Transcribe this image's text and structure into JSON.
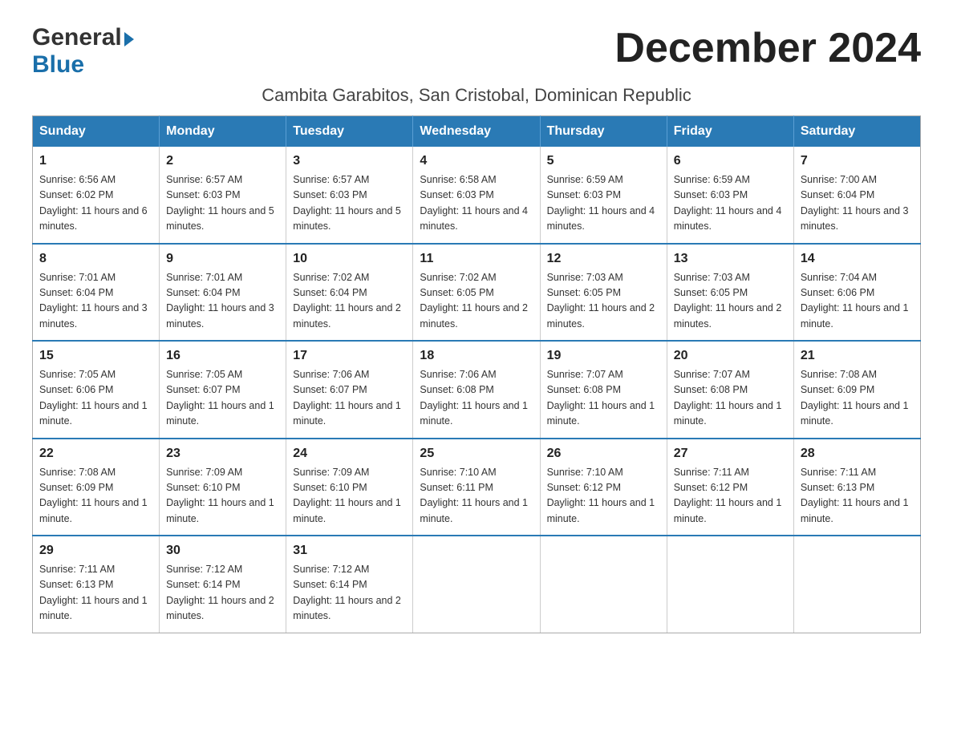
{
  "header": {
    "logo_general": "General",
    "logo_blue": "Blue",
    "month_title": "December 2024",
    "location": "Cambita Garabitos, San Cristobal, Dominican Republic"
  },
  "weekdays": [
    "Sunday",
    "Monday",
    "Tuesday",
    "Wednesday",
    "Thursday",
    "Friday",
    "Saturday"
  ],
  "weeks": [
    [
      {
        "day": "1",
        "sunrise": "Sunrise: 6:56 AM",
        "sunset": "Sunset: 6:02 PM",
        "daylight": "Daylight: 11 hours and 6 minutes."
      },
      {
        "day": "2",
        "sunrise": "Sunrise: 6:57 AM",
        "sunset": "Sunset: 6:03 PM",
        "daylight": "Daylight: 11 hours and 5 minutes."
      },
      {
        "day": "3",
        "sunrise": "Sunrise: 6:57 AM",
        "sunset": "Sunset: 6:03 PM",
        "daylight": "Daylight: 11 hours and 5 minutes."
      },
      {
        "day": "4",
        "sunrise": "Sunrise: 6:58 AM",
        "sunset": "Sunset: 6:03 PM",
        "daylight": "Daylight: 11 hours and 4 minutes."
      },
      {
        "day": "5",
        "sunrise": "Sunrise: 6:59 AM",
        "sunset": "Sunset: 6:03 PM",
        "daylight": "Daylight: 11 hours and 4 minutes."
      },
      {
        "day": "6",
        "sunrise": "Sunrise: 6:59 AM",
        "sunset": "Sunset: 6:03 PM",
        "daylight": "Daylight: 11 hours and 4 minutes."
      },
      {
        "day": "7",
        "sunrise": "Sunrise: 7:00 AM",
        "sunset": "Sunset: 6:04 PM",
        "daylight": "Daylight: 11 hours and 3 minutes."
      }
    ],
    [
      {
        "day": "8",
        "sunrise": "Sunrise: 7:01 AM",
        "sunset": "Sunset: 6:04 PM",
        "daylight": "Daylight: 11 hours and 3 minutes."
      },
      {
        "day": "9",
        "sunrise": "Sunrise: 7:01 AM",
        "sunset": "Sunset: 6:04 PM",
        "daylight": "Daylight: 11 hours and 3 minutes."
      },
      {
        "day": "10",
        "sunrise": "Sunrise: 7:02 AM",
        "sunset": "Sunset: 6:04 PM",
        "daylight": "Daylight: 11 hours and 2 minutes."
      },
      {
        "day": "11",
        "sunrise": "Sunrise: 7:02 AM",
        "sunset": "Sunset: 6:05 PM",
        "daylight": "Daylight: 11 hours and 2 minutes."
      },
      {
        "day": "12",
        "sunrise": "Sunrise: 7:03 AM",
        "sunset": "Sunset: 6:05 PM",
        "daylight": "Daylight: 11 hours and 2 minutes."
      },
      {
        "day": "13",
        "sunrise": "Sunrise: 7:03 AM",
        "sunset": "Sunset: 6:05 PM",
        "daylight": "Daylight: 11 hours and 2 minutes."
      },
      {
        "day": "14",
        "sunrise": "Sunrise: 7:04 AM",
        "sunset": "Sunset: 6:06 PM",
        "daylight": "Daylight: 11 hours and 1 minute."
      }
    ],
    [
      {
        "day": "15",
        "sunrise": "Sunrise: 7:05 AM",
        "sunset": "Sunset: 6:06 PM",
        "daylight": "Daylight: 11 hours and 1 minute."
      },
      {
        "day": "16",
        "sunrise": "Sunrise: 7:05 AM",
        "sunset": "Sunset: 6:07 PM",
        "daylight": "Daylight: 11 hours and 1 minute."
      },
      {
        "day": "17",
        "sunrise": "Sunrise: 7:06 AM",
        "sunset": "Sunset: 6:07 PM",
        "daylight": "Daylight: 11 hours and 1 minute."
      },
      {
        "day": "18",
        "sunrise": "Sunrise: 7:06 AM",
        "sunset": "Sunset: 6:08 PM",
        "daylight": "Daylight: 11 hours and 1 minute."
      },
      {
        "day": "19",
        "sunrise": "Sunrise: 7:07 AM",
        "sunset": "Sunset: 6:08 PM",
        "daylight": "Daylight: 11 hours and 1 minute."
      },
      {
        "day": "20",
        "sunrise": "Sunrise: 7:07 AM",
        "sunset": "Sunset: 6:08 PM",
        "daylight": "Daylight: 11 hours and 1 minute."
      },
      {
        "day": "21",
        "sunrise": "Sunrise: 7:08 AM",
        "sunset": "Sunset: 6:09 PM",
        "daylight": "Daylight: 11 hours and 1 minute."
      }
    ],
    [
      {
        "day": "22",
        "sunrise": "Sunrise: 7:08 AM",
        "sunset": "Sunset: 6:09 PM",
        "daylight": "Daylight: 11 hours and 1 minute."
      },
      {
        "day": "23",
        "sunrise": "Sunrise: 7:09 AM",
        "sunset": "Sunset: 6:10 PM",
        "daylight": "Daylight: 11 hours and 1 minute."
      },
      {
        "day": "24",
        "sunrise": "Sunrise: 7:09 AM",
        "sunset": "Sunset: 6:10 PM",
        "daylight": "Daylight: 11 hours and 1 minute."
      },
      {
        "day": "25",
        "sunrise": "Sunrise: 7:10 AM",
        "sunset": "Sunset: 6:11 PM",
        "daylight": "Daylight: 11 hours and 1 minute."
      },
      {
        "day": "26",
        "sunrise": "Sunrise: 7:10 AM",
        "sunset": "Sunset: 6:12 PM",
        "daylight": "Daylight: 11 hours and 1 minute."
      },
      {
        "day": "27",
        "sunrise": "Sunrise: 7:11 AM",
        "sunset": "Sunset: 6:12 PM",
        "daylight": "Daylight: 11 hours and 1 minute."
      },
      {
        "day": "28",
        "sunrise": "Sunrise: 7:11 AM",
        "sunset": "Sunset: 6:13 PM",
        "daylight": "Daylight: 11 hours and 1 minute."
      }
    ],
    [
      {
        "day": "29",
        "sunrise": "Sunrise: 7:11 AM",
        "sunset": "Sunset: 6:13 PM",
        "daylight": "Daylight: 11 hours and 1 minute."
      },
      {
        "day": "30",
        "sunrise": "Sunrise: 7:12 AM",
        "sunset": "Sunset: 6:14 PM",
        "daylight": "Daylight: 11 hours and 2 minutes."
      },
      {
        "day": "31",
        "sunrise": "Sunrise: 7:12 AM",
        "sunset": "Sunset: 6:14 PM",
        "daylight": "Daylight: 11 hours and 2 minutes."
      },
      null,
      null,
      null,
      null
    ]
  ]
}
